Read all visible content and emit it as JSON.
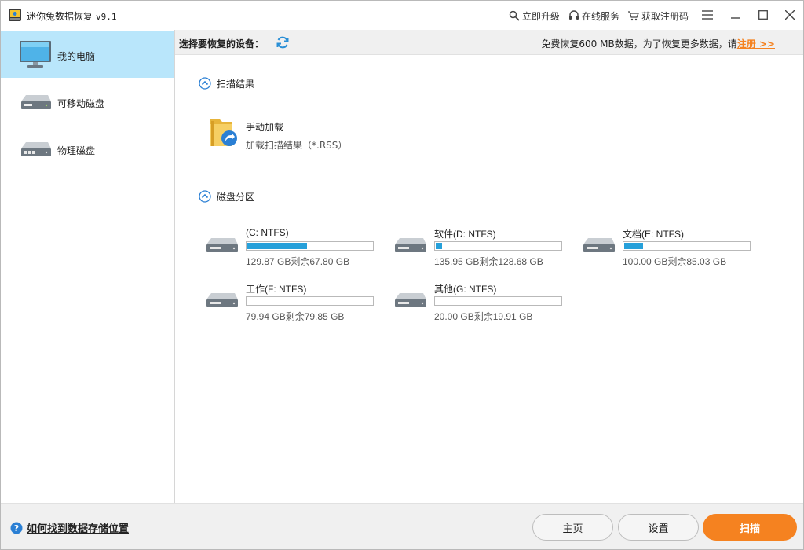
{
  "app": {
    "title": "迷你兔数据恢复",
    "version": "v9.1"
  },
  "titlebar_links": [
    {
      "label": "立即升级",
      "icon": "search-upgrade-icon"
    },
    {
      "label": "在线服务",
      "icon": "headset-icon"
    },
    {
      "label": "获取注册码",
      "icon": "cart-icon"
    }
  ],
  "sidebar": {
    "items": [
      {
        "label": "我的电脑",
        "icon": "monitor-icon",
        "active": true
      },
      {
        "label": "可移动磁盘",
        "icon": "removable-disk-icon",
        "active": false
      },
      {
        "label": "物理磁盘",
        "icon": "physical-disk-icon",
        "active": false
      }
    ]
  },
  "header": {
    "select_label": "选择要恢复的设备：",
    "free_note": "免费恢复600 MB数据，为了恢复更多数据，请",
    "register_link": "注册 >>"
  },
  "scan_results": {
    "title": "扫描结果",
    "manual_load": {
      "title": "手动加载",
      "subtitle": "加载扫描结果（*.RSS）"
    }
  },
  "partitions": {
    "title": "磁盘分区",
    "drives": [
      {
        "name": "(C: NTFS)",
        "size": "129.87 GB剩余67.80 GB",
        "used_fraction": 0.478
      },
      {
        "name": "软件(D: NTFS)",
        "size": "135.95 GB剩余128.68 GB",
        "used_fraction": 0.053
      },
      {
        "name": "文档(E: NTFS)",
        "size": "100.00 GB剩余85.03 GB",
        "used_fraction": 0.15
      },
      {
        "name": "工作(F: NTFS)",
        "size": "79.94 GB剩余79.85 GB",
        "used_fraction": 0.001
      },
      {
        "name": "其他(G: NTFS)",
        "size": "20.00 GB剩余19.91 GB",
        "used_fraction": 0.005
      }
    ]
  },
  "footer": {
    "help_text": "如何找到数据存储位置",
    "home_label": "主页",
    "settings_label": "设置",
    "scan_label": "扫描"
  },
  "colors": {
    "accent": "#f58220",
    "active_bg": "#b9e6fb",
    "bar_fill": "#26a0da"
  }
}
